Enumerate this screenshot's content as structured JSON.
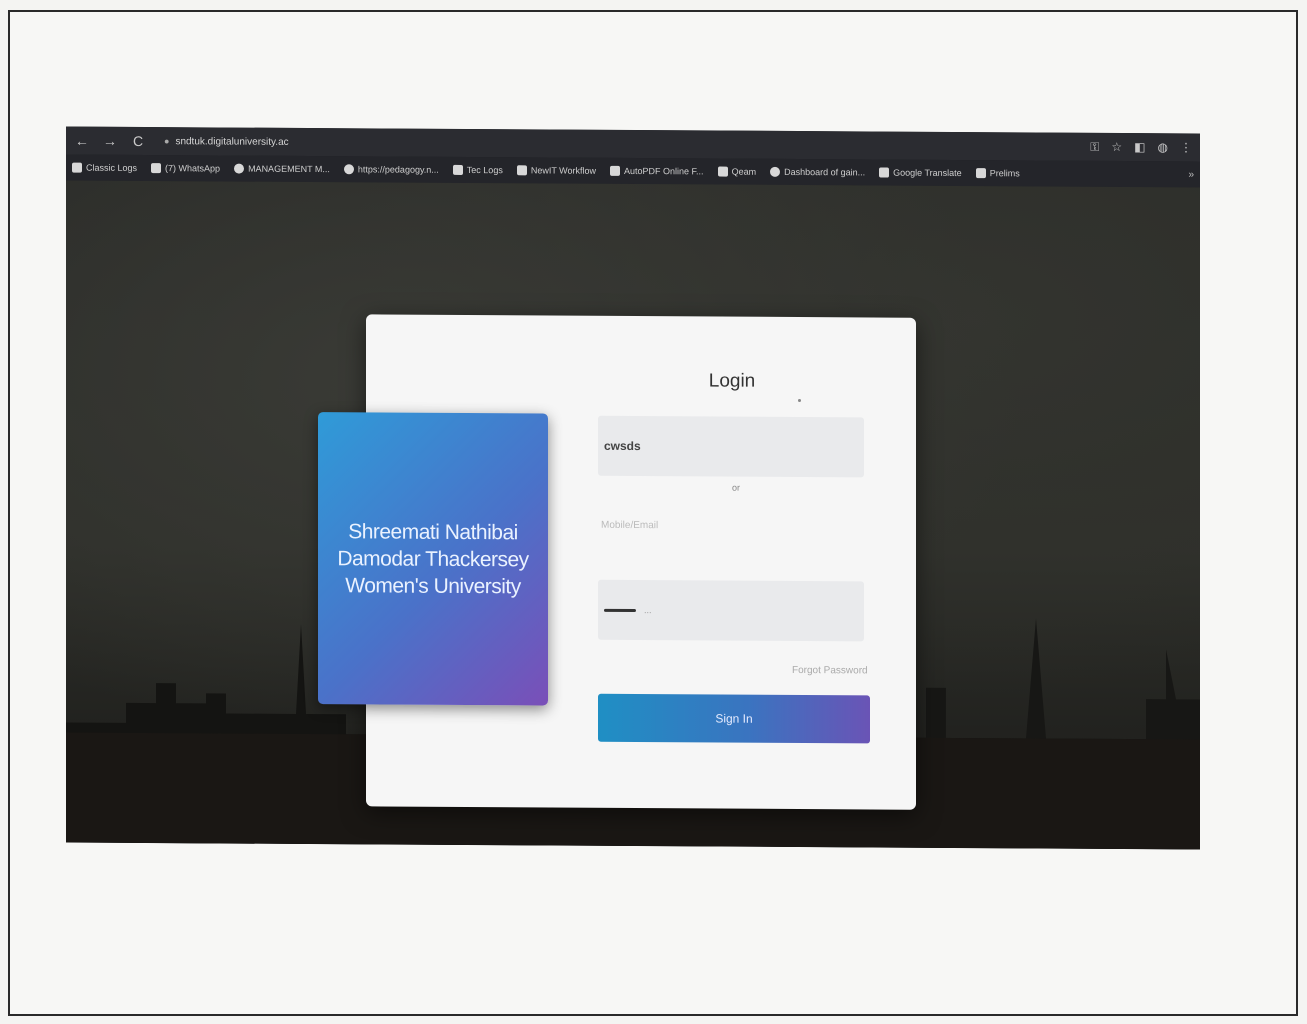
{
  "browser": {
    "url": "sndtuk.digitaluniversity.ac",
    "nav": {
      "back": "←",
      "forward": "→",
      "reload": "C"
    },
    "toolbar_icons": [
      "key-icon",
      "star-icon",
      "extension-icon",
      "profile-icon",
      "menu-icon"
    ],
    "bookmarks": [
      {
        "label": "Classic Logs",
        "icon": "bookmark-icon"
      },
      {
        "label": "(7) WhatsApp",
        "icon": "whatsapp-icon"
      },
      {
        "label": "MANAGEMENT M...",
        "icon": "globe-icon"
      },
      {
        "label": "https://pedagogy.n...",
        "icon": "globe-icon"
      },
      {
        "label": "Tec Logs",
        "icon": "bookmark-icon"
      },
      {
        "label": "NewIT Workflow",
        "icon": "bookmark-icon"
      },
      {
        "label": "AutoPDF Online F...",
        "icon": "bookmark-icon"
      },
      {
        "label": "Qeam",
        "icon": "bookmark-icon"
      },
      {
        "label": "Dashboard of gain...",
        "icon": "globe-icon"
      },
      {
        "label": "Google Translate",
        "icon": "translate-icon"
      },
      {
        "label": "Prelims",
        "icon": "bookmark-icon"
      }
    ],
    "bookmarks_more": "»"
  },
  "login": {
    "university_name": "Shreemati Nathibai Damodar Thackersey Women's University",
    "title": "Login",
    "username_value": "cwsds",
    "or_text": "or",
    "alt_placeholder": "Mobile/Email",
    "password_hint": "...",
    "forgot_link": "Forgot Password",
    "signin_label": "Sign In"
  }
}
